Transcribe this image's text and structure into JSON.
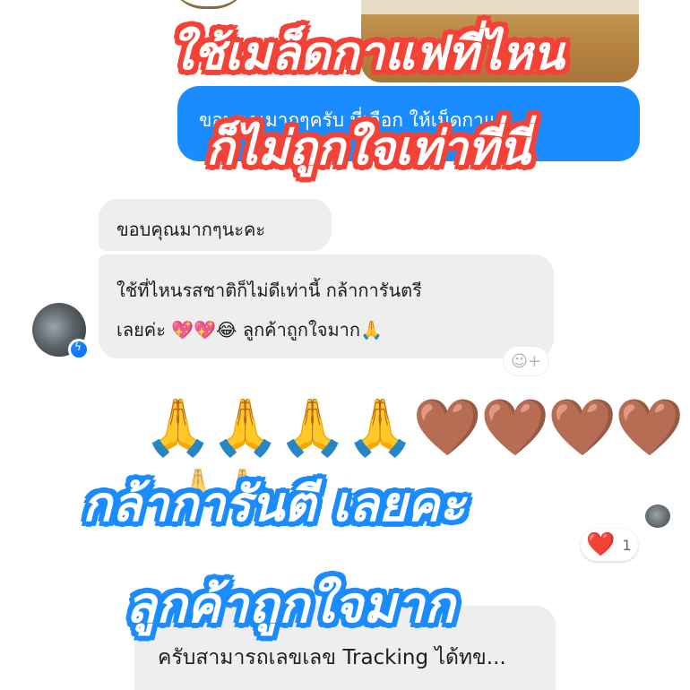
{
  "colors": {
    "sent_bubble": "#1a8cff",
    "received_bubble": "#eeeeef",
    "overlay_red": "#f44336",
    "overlay_blue": "#1a8cff",
    "heart": "#e0162b"
  },
  "chat": {
    "sent_message": "ขอบคุณมากๆครับ ที่เลือก ให้เม็ดกาแฟ",
    "received_messages": [
      "ขอบคุณมากๆนะคะ",
      "ใช้ที่ไหนรสชาติก็ไม่ดีเท่านี้ กล้าการันตรี",
      "เลยค่ะ 💖💖😂 ลูกค้าถูกใจมาก🙏"
    ],
    "add_reaction_icon": "smile-plus-icon",
    "emoji_reply": "🙏🙏🙏🙏🤎🤎🤎🤎",
    "emoji_reply_partial": "🙏🙏",
    "heart_reaction": "❤️",
    "reaction_count": "1",
    "bottom_message": "ครับสามารถเลขเลข Tracking ได้ทข..."
  },
  "overlays": {
    "line1": "ใช้เมล็ดกาแฟที่ไหน",
    "line2": "ก็ไม่ถูกใจเท่าที่นี่",
    "line3": "กล้าการันตี เลยคะ",
    "line4": "ลูกค้าถูกใจมาก"
  }
}
